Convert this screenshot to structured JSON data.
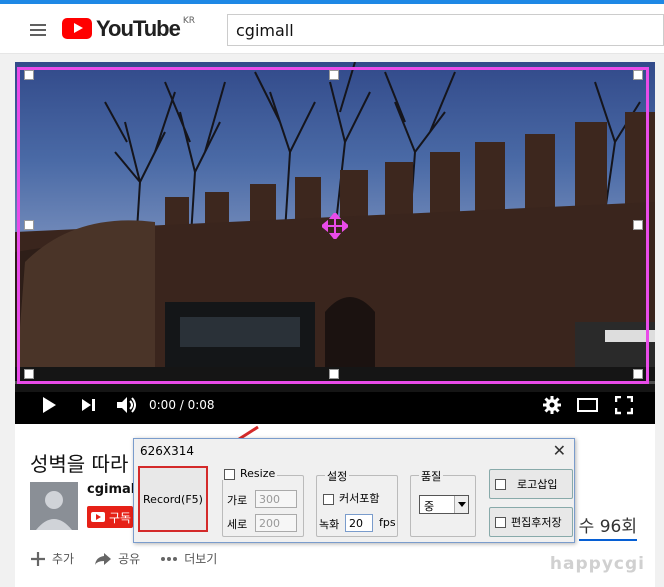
{
  "header": {
    "logo_text": "YouTube",
    "country": "KR",
    "search_value": "cgimall"
  },
  "player": {
    "time": "0:00 / 0:08"
  },
  "video": {
    "title": "성벽을 따라",
    "channel": "cgimall",
    "subscribe": "구독",
    "views": "수 96회",
    "actions": {
      "add": "추가",
      "share": "공유",
      "more": "더보기"
    },
    "watermark": "happycgi"
  },
  "dialog": {
    "title": "626X314",
    "record": "Record(F5)",
    "resize_label": "Resize",
    "width_label": "가로",
    "width_value": "300",
    "height_label": "세로",
    "height_value": "200",
    "settings_label": "설정",
    "cursor_label": "커서포함",
    "fps_label_prefix": "녹화",
    "fps_value": "20",
    "fps_unit": "fps",
    "quality_label": "품질",
    "quality_value": "중",
    "logo_insert": "로고삽입",
    "edit_save": "편집후저장"
  },
  "colors": {
    "accent": "#1e88e5",
    "youtube_red": "#ff0000",
    "selection": "#e94be9",
    "record_border": "#d42a2a"
  }
}
